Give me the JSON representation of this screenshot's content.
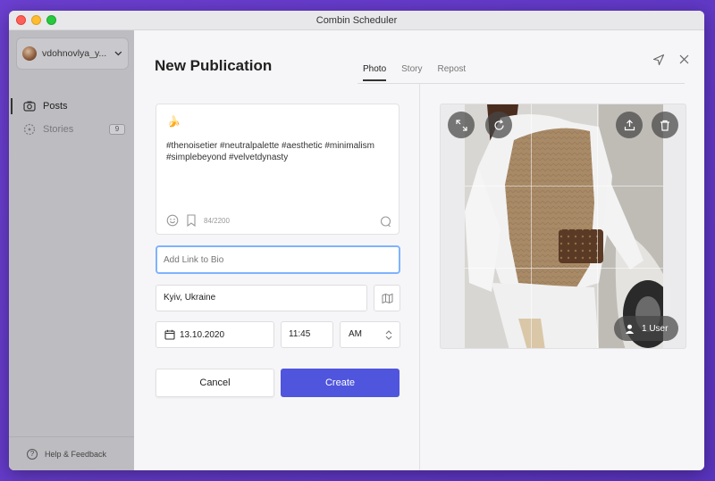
{
  "window": {
    "title": "Combin Scheduler"
  },
  "sidebar": {
    "account": "vdohnovlya_y...",
    "items": [
      {
        "label": "Posts",
        "icon": "posts-icon",
        "active": true
      },
      {
        "label": "Stories",
        "icon": "stories-icon",
        "badge": "9",
        "active": false
      }
    ],
    "help": "Help & Feedback"
  },
  "header": {
    "title": "New Publication",
    "tabs": [
      "Photo",
      "Story",
      "Repost"
    ],
    "active_tab": "Photo"
  },
  "composer": {
    "emoji": "🍌",
    "caption": "#thenoisetier #neutralpalette #aesthetic #minimalism #simplebeyond #velvetdynasty",
    "char_count": "84/2200",
    "link_placeholder": "Add Link to Bio",
    "location": "Kyiv, Ukraine",
    "date": "13.10.2020",
    "time": "11:45",
    "ampm": "AM",
    "cancel_label": "Cancel",
    "create_label": "Create"
  },
  "preview": {
    "user_tag": "1 User"
  },
  "colors": {
    "accent": "#4f55dc",
    "focus": "#7fb3ff",
    "sidebar": "#bdbcc0",
    "background": "#6a3fc6"
  }
}
